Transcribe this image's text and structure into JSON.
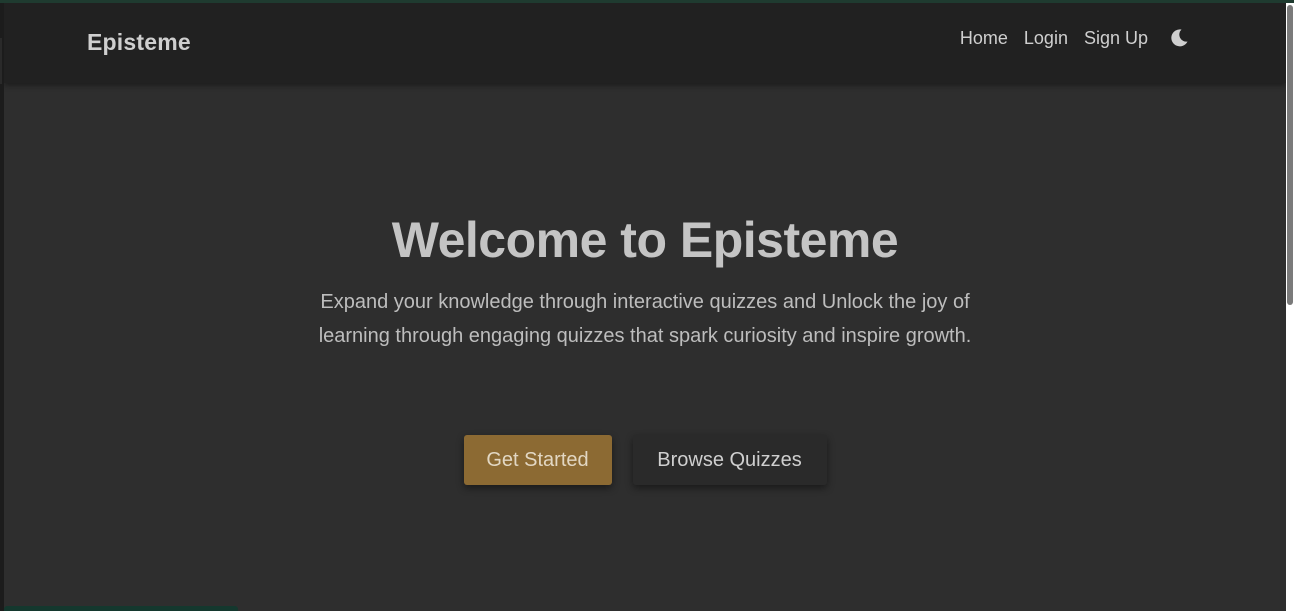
{
  "navbar": {
    "brand": "Episteme",
    "links": [
      {
        "label": "Home"
      },
      {
        "label": "Login"
      },
      {
        "label": "Sign Up"
      }
    ],
    "theme_toggle_icon": "moon-icon"
  },
  "hero": {
    "title": "Welcome to Episteme",
    "subtitle": "Expand your knowledge through interactive quizzes and Unlock the joy of learning through engaging quizzes that spark curiosity and inspire growth.",
    "primary_button": "Get Started",
    "secondary_button": "Browse Quizzes"
  },
  "colors": {
    "accent": "#8c6a33",
    "page_background": "#2e2e2e",
    "navbar_background": "#212121"
  }
}
